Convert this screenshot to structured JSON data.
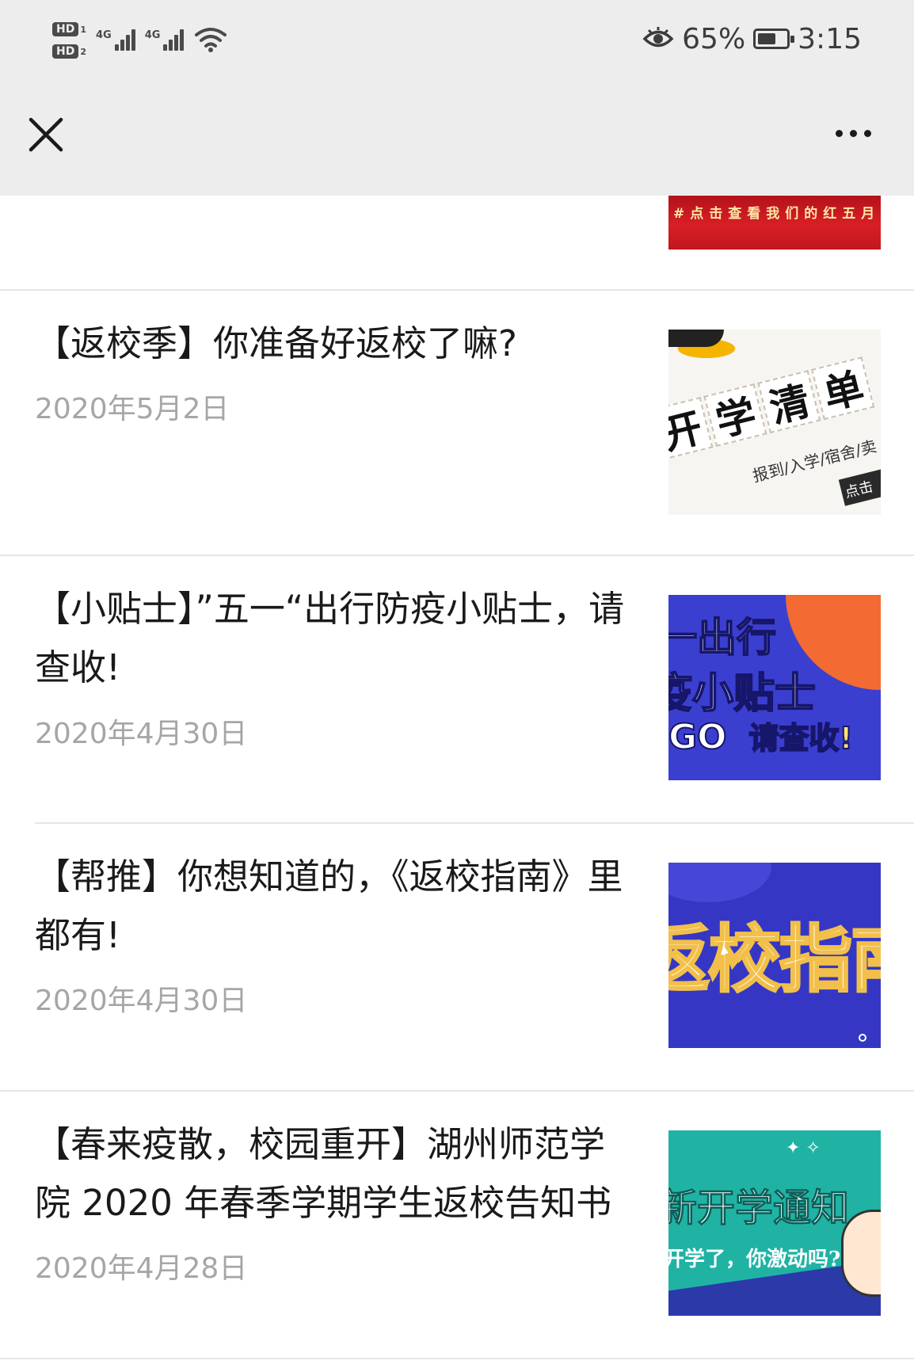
{
  "status_bar": {
    "hd1": "HD",
    "hd1_num": "1",
    "hd2": "HD",
    "hd2_num": "2",
    "net1": "4G",
    "net2": "4G",
    "battery_percent": "65%",
    "battery_level": 0.65,
    "time": "3:15"
  },
  "nav": {
    "close_icon": "close-icon",
    "more_icon": "more-icon"
  },
  "partial_item": {
    "thumb_text": "#点击查看我们的红五月"
  },
  "articles": [
    {
      "title": "【返校季】你准备好返校了嘛?",
      "date": "2020年5月2日",
      "thumb": {
        "chars": [
          "开",
          "学",
          "清",
          "单"
        ],
        "subtitle": "报到/入学/宿舍/卖",
        "tag": "点击"
      }
    },
    {
      "title": "【小贴士】”五一“出行防疫小贴士，请查收!",
      "date": "2020年4月30日",
      "thumb": {
        "line1": "一出行",
        "line2": "疫小贴士",
        "line3_go": "GO",
        "line3_check": "请查收!"
      }
    },
    {
      "title": "【帮推】你想知道的，《返校指南》里都有!",
      "date": "2020年4月30日",
      "thumb": {
        "big": "返校指南"
      }
    },
    {
      "title": "【春来疫散，校园重开】湖州师范学院 2020 年春季学期学生返校告知书",
      "date": "2020年4月28日",
      "thumb": {
        "title": "新开学通知",
        "subtitle": "开学了，你激动吗?"
      }
    }
  ],
  "colors": {
    "header_bg": "#ededed",
    "date_text": "#a6a6a6",
    "divider": "#e6e6e6"
  }
}
